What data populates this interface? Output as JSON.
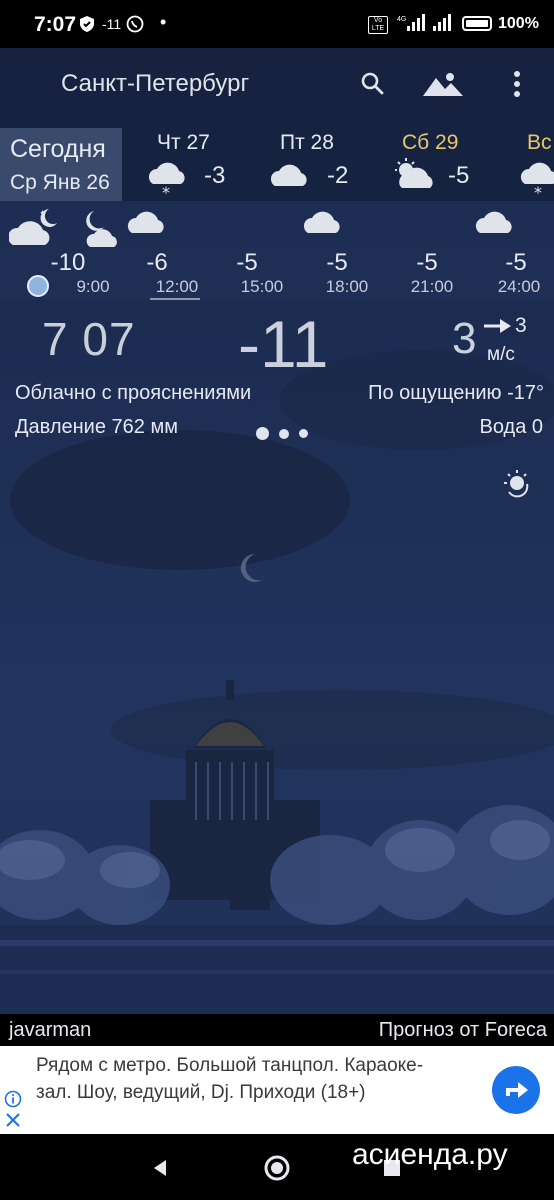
{
  "status_bar": {
    "time": "7:07",
    "temp": "-11",
    "battery": "100%",
    "volte": "Vo LTE",
    "network": "4G"
  },
  "header": {
    "city": "Санкт-Петербург",
    "icons": [
      "search-icon",
      "image-icon",
      "more-vert-icon"
    ]
  },
  "days": [
    {
      "name": "Сегодня",
      "date": "Ср Янв 26"
    },
    {
      "name": "Чт 27",
      "temp": "-3",
      "icon": "cloud-snow-icon"
    },
    {
      "name": "Пт 28",
      "temp": "-2",
      "icon": "cloud-icon"
    },
    {
      "name": "Сб 29",
      "temp": "-5",
      "icon": "sun-cloud-icon"
    },
    {
      "name": "Вс",
      "icon": "cloud-snow-icon"
    }
  ],
  "hourly": [
    {
      "temp": "-10",
      "time": "9:00",
      "icon": "night-cloud-icon"
    },
    {
      "temp": "-6",
      "time": "12:00",
      "icon": "moon-cloud-icon"
    },
    {
      "temp": "-5",
      "time": "15:00",
      "icon": "cloud-icon"
    },
    {
      "temp": "-5",
      "time": "18:00",
      "icon": "cloud-icon"
    },
    {
      "temp": "-5",
      "time": "21:00",
      "icon": ""
    },
    {
      "temp": "-5",
      "time": "24:00",
      "icon": "cloud-icon"
    }
  ],
  "current": {
    "clock": "7 07",
    "temperature": "-11",
    "wind_speed": "3",
    "wind_dir": "3",
    "wind_unit": "м/с",
    "condition": "Облачно с прояснениями",
    "feels_like": "По ощущению -17°",
    "pressure": "Давление 762 мм",
    "water": "Вода 0"
  },
  "footer": {
    "user": "javarman",
    "source": "Прогноз от Foreca"
  },
  "ad": {
    "text": "Рядом с метро. Большой танцпол. Караоке-зал. Шоу, ведущий, Dj. Приходи (18+)"
  },
  "watermark": "асиенда.ру",
  "colors": {
    "background": "#1f2f56",
    "header": "#16223e",
    "today": "#3a4a6c",
    "saturday": "#e5c86b",
    "ad_accent": "#1a73e8"
  }
}
